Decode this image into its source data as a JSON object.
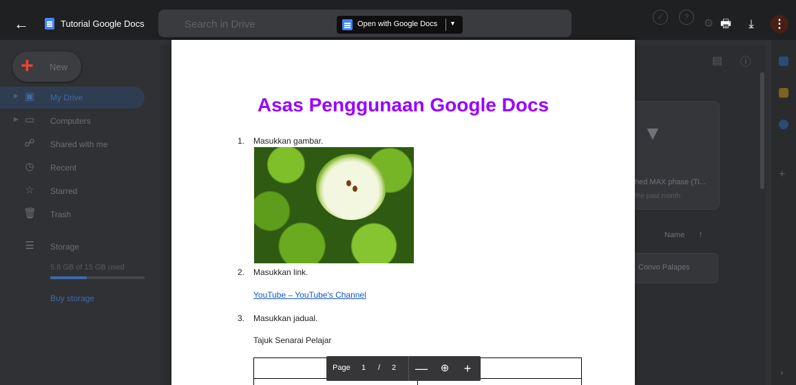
{
  "toolbar": {
    "doc_title": "Tutorial Google Docs",
    "open_with_label": "Open with Google Docs"
  },
  "drive_background": {
    "search_placeholder": "Search in Drive",
    "new_label": "New",
    "sidebar": [
      {
        "label": "My Drive",
        "icon": "drive-icon",
        "active": true
      },
      {
        "label": "Computers",
        "icon": "computer-icon",
        "active": false
      },
      {
        "label": "Shared with me",
        "icon": "people-icon",
        "active": false
      },
      {
        "label": "Recent",
        "icon": "clock-icon",
        "active": false
      },
      {
        "label": "Starred",
        "icon": "star-icon",
        "active": false
      },
      {
        "label": "Trash",
        "icon": "trash-icon",
        "active": false
      }
    ],
    "storage_label": "Storage",
    "storage_used": "5.8 GB of 15 GB used",
    "storage_fraction": 0.39,
    "buy_storage": "Buy storage",
    "card_title": "hed MAX phase (Ti...",
    "card_sub": "the past month",
    "sort_label": "Name",
    "folder_label": "Convo Palapes"
  },
  "document": {
    "title": "Asas Penggunaan Google Docs",
    "items": [
      {
        "num": "1.",
        "text": "Masukkan gambar."
      },
      {
        "num": "2.",
        "text": "Masukkan link."
      },
      {
        "num": "3.",
        "text": "Masukkan jadual."
      }
    ],
    "link_text": "YouTube – YouTube's Channel",
    "table_caption": "Tajuk Senarai Pelajar",
    "image_subject": "green apples"
  },
  "pager": {
    "label": "Page",
    "current": "1",
    "separator": "/",
    "total": "2"
  },
  "colors": {
    "title_purple": "#9900ff",
    "link_blue": "#1155cc",
    "docs_blue": "#4285f4"
  }
}
